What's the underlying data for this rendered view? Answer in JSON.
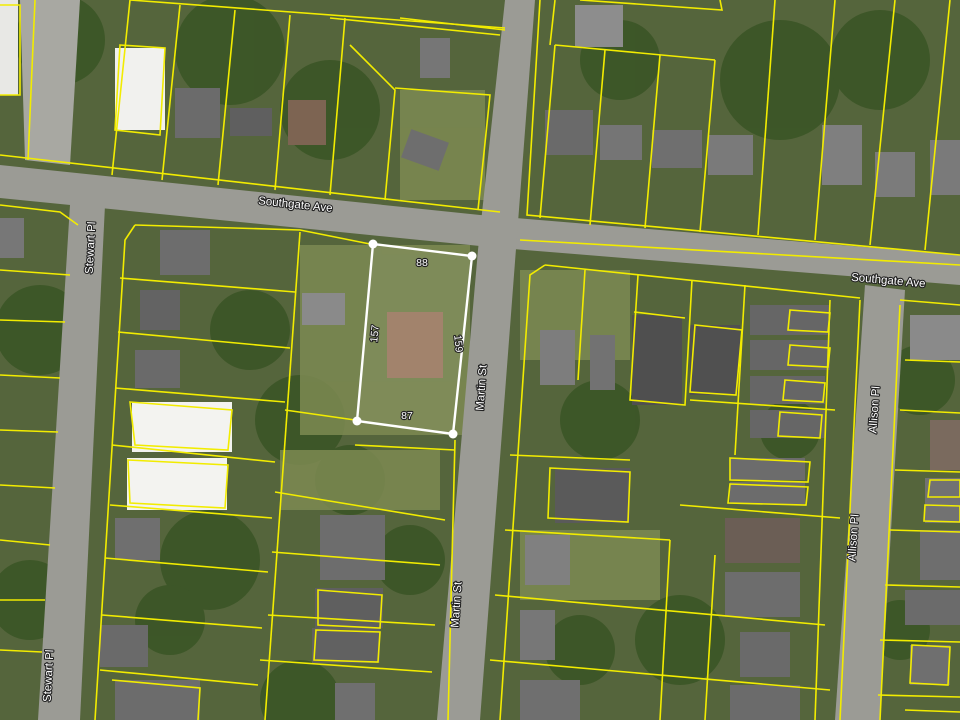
{
  "map": {
    "road_labels": {
      "southgate_ave_west": "Southgate Ave",
      "southgate_ave_east": "Southgate Ave",
      "stewart_pl_north": "Stewart Pl",
      "stewart_pl_south": "Stewart Pl",
      "martin_st_north": "Martin St",
      "martin_st_south": "Martin St",
      "allison_pl_north": "Allison Pl",
      "allison_pl_south": "Allison Pl"
    },
    "subject_parcel": {
      "dimensions": {
        "north": "88",
        "east": "159",
        "south": "87",
        "west": "157"
      }
    },
    "colors": {
      "parcel_lines": "#f2ec00",
      "subject_outline": "#ffffff",
      "vegetation": "#3f5a2a",
      "road": "#9a9a94"
    }
  }
}
